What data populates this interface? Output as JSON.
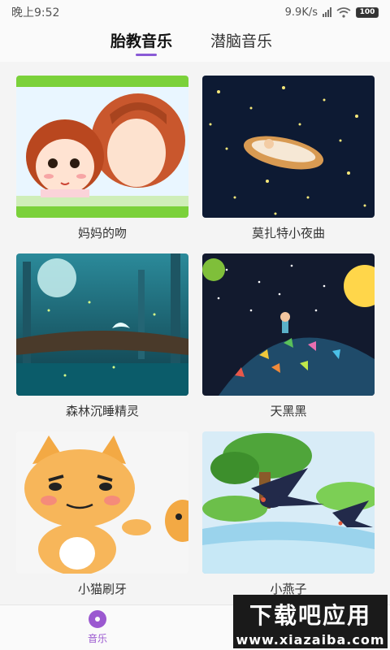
{
  "status_bar": {
    "time": "晚上9:52",
    "speed": "9.9K/s",
    "battery": "100"
  },
  "tabs": [
    {
      "label": "胎教音乐",
      "active": true
    },
    {
      "label": "潜脑音乐",
      "active": false
    }
  ],
  "cards": [
    {
      "title": "妈妈的吻"
    },
    {
      "title": "莫扎特小夜曲"
    },
    {
      "title": "森林沉睡精灵"
    },
    {
      "title": "天黑黑"
    },
    {
      "title": "小猫刷牙"
    },
    {
      "title": "小燕子"
    }
  ],
  "bottom_nav": {
    "label": "音乐"
  },
  "watermark": {
    "main": "下载吧应用",
    "sub": "www.xiazaiba.com"
  },
  "colors": {
    "accent": "#8a5ad6",
    "nav_active": "#9b59d0"
  }
}
